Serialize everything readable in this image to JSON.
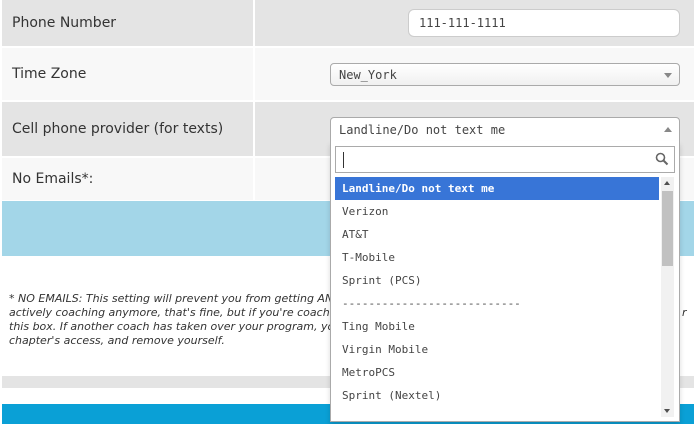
{
  "form": {
    "phone": {
      "label": "Phone Number",
      "value": "111-111-1111"
    },
    "timezone": {
      "label": "Time Zone",
      "value": "New_York"
    },
    "provider": {
      "label": "Cell phone provider (for texts)",
      "value": "Landline/Do not text me"
    },
    "no_emails": {
      "label": "No Emails*:"
    }
  },
  "note": {
    "lines": [
      "* NO EMAILS: This setting will prevent you from getting AN",
      "actively coaching anymore, that's fine, but if you're coachin",
      "this box. If another coach has taken over your program, yo",
      "chapter's access, and remove yourself."
    ],
    "right_fragment": "r"
  },
  "dropdown": {
    "search_value": "",
    "options": [
      "Landline/Do not text me",
      "Verizon",
      "AT&T",
      "T-Mobile",
      "Sprint (PCS)",
      "---------------------------",
      "Ting Mobile",
      "Virgin Mobile",
      "MetroPCS",
      "Sprint (Nextel)"
    ],
    "highlighted_index": 0,
    "icons": {
      "search": "search-icon"
    }
  },
  "colors": {
    "row_shaded": "#e4e4e4",
    "highlight": "#3875d7",
    "blue_band": "#a3d6e8",
    "footer_blue": "#0aa0d6"
  }
}
